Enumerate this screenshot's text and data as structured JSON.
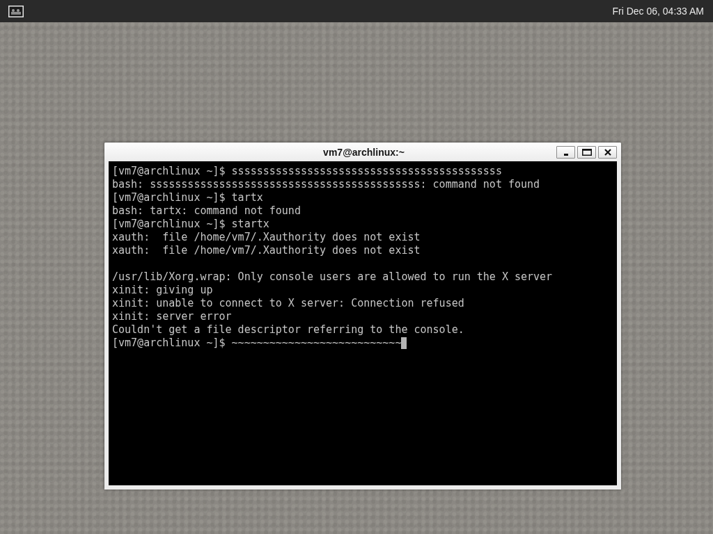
{
  "top_bar": {
    "clock": "Fri Dec 06, 04:33 AM"
  },
  "window": {
    "title": "vm7@archlinux:~",
    "buttons": [
      {
        "kind": "minimize"
      },
      {
        "kind": "maximize"
      },
      {
        "kind": "close"
      }
    ]
  },
  "terminal": {
    "lines": [
      {
        "kind": "text",
        "text": "[vm7@archlinux ~]$ sssssssssssssssssssssssssssssssssssssssssss"
      },
      {
        "kind": "text",
        "text": "bash: sssssssssssssssssssssssssssssssssssssssssss: command not found"
      },
      {
        "kind": "text",
        "text": "[vm7@archlinux ~]$ tartx"
      },
      {
        "kind": "text",
        "text": "bash: tartx: command not found"
      },
      {
        "kind": "text",
        "text": "[vm7@archlinux ~]$ startx"
      },
      {
        "kind": "text",
        "text": "xauth:  file /home/vm7/.Xauthority does not exist"
      },
      {
        "kind": "text",
        "text": "xauth:  file /home/vm7/.Xauthority does not exist"
      },
      {
        "kind": "blank"
      },
      {
        "kind": "text",
        "text": "/usr/lib/Xorg.wrap: Only console users are allowed to run the X server"
      },
      {
        "kind": "text",
        "text": "xinit: giving up"
      },
      {
        "kind": "text",
        "text": "xinit: unable to connect to X server: Connection refused"
      },
      {
        "kind": "text",
        "text": "xinit: server error"
      },
      {
        "kind": "text",
        "text": "Couldn't get a file descriptor referring to the console."
      },
      {
        "kind": "text",
        "text": "[vm7@archlinux ~]$ ~~~~~~~~~~~~~~~~~~~~~~~~~~~"
      }
    ],
    "cursor": true
  }
}
